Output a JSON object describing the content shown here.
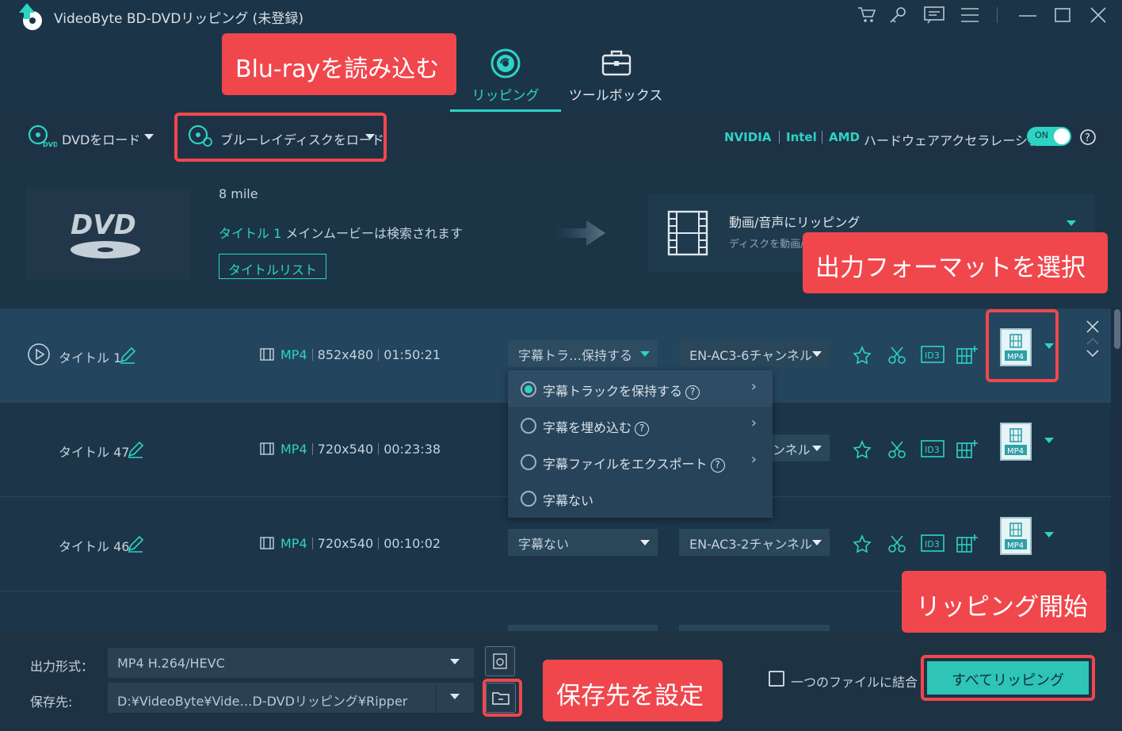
{
  "app": {
    "title": "VideoByte BD-DVDリッピング (未登録)"
  },
  "tabs": [
    {
      "label": "リッピング",
      "active": true
    },
    {
      "label": "ツールボックス",
      "active": false
    }
  ],
  "toolbar": {
    "load_dvd": "DVDをロード",
    "load_bluray": "ブルーレイディスクをロード",
    "hw_brands": [
      "NVIDIA",
      "Intel",
      "AMD"
    ],
    "hw_label": "ハードウェアアクセラレーション",
    "toggle_state": "ON"
  },
  "source": {
    "disc_name": "8 mile",
    "title_link": "タイトル 1",
    "main_movie_text": "メインムービーは検索されます",
    "title_list_button": "タイトルリスト",
    "dvd_logo": "DVD"
  },
  "profile": {
    "title": "動画/音声にリッピング",
    "subtitle": "ディスクを動画/音"
  },
  "titles": [
    {
      "name": "タイトル 1",
      "format": "MP4",
      "resolution": "852x480",
      "duration": "01:50:21",
      "subtitle_select": "字幕トラ…保持する",
      "audio_select": "EN-AC3-6チャンネル",
      "format_icon": "MP4"
    },
    {
      "name": "タイトル 47",
      "format": "MP4",
      "resolution": "720x540",
      "duration": "00:23:38",
      "subtitle_select": "",
      "audio_select": "ンネル",
      "format_icon": "MP4"
    },
    {
      "name": "タイトル 46",
      "format": "MP4",
      "resolution": "720x540",
      "duration": "00:10:02",
      "subtitle_select": "字幕ない",
      "audio_select": "EN-AC3-2チャンネル",
      "format_icon": "MP4"
    }
  ],
  "subtitle_menu": [
    {
      "label": "字幕トラックを保持する",
      "selected": true
    },
    {
      "label": "字幕を埋め込む",
      "selected": false
    },
    {
      "label": "字幕ファイルをエクスポート",
      "selected": false
    },
    {
      "label": "字幕ない",
      "selected": false
    }
  ],
  "bottom": {
    "output_format_label": "出力形式：",
    "output_format_value": "MP4 H.264/HEVC",
    "save_to_label": "保存先:",
    "save_to_value": "D:¥VideoByte¥Vide…D-DVDリッピング¥Ripper",
    "merge_label": "一つのファイルに結合",
    "rip_all": "すべてリッピング"
  },
  "annotations": {
    "load_bluray": "Blu-rayを読み込む",
    "select_format": "出力フォーマットを選択",
    "start_ripping": "リッピング開始",
    "set_destination": "保存先を設定"
  },
  "colors": {
    "accent": "#2ed3c4",
    "callout": "#f0474d",
    "background": "#1b3042"
  }
}
